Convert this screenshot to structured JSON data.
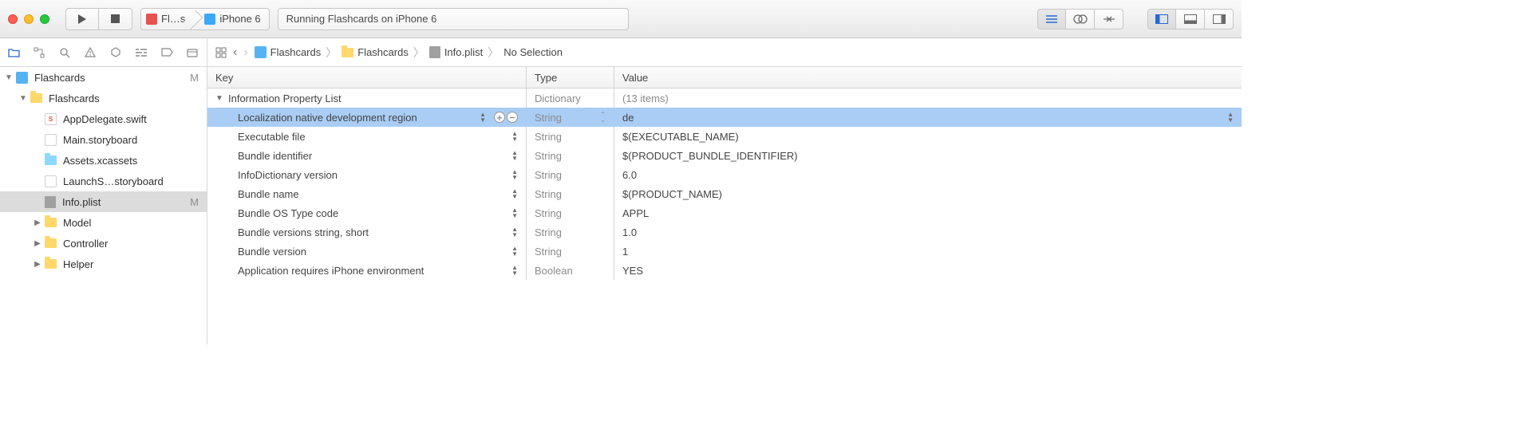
{
  "toolbar": {
    "scheme_target": "Fl…s",
    "scheme_device": "iPhone 6",
    "status": "Running Flashcards on iPhone 6"
  },
  "jump_bar": {
    "items": [
      {
        "icon": "project",
        "label": "Flashcards"
      },
      {
        "icon": "folder",
        "label": "Flashcards"
      },
      {
        "icon": "plist",
        "label": "Info.plist"
      },
      {
        "icon": "",
        "label": "No Selection"
      }
    ]
  },
  "sidebar": {
    "items": [
      {
        "depth": 0,
        "icon": "project",
        "label": "Flashcards",
        "badge": "M",
        "disclosure": "open"
      },
      {
        "depth": 1,
        "icon": "folder",
        "label": "Flashcards",
        "disclosure": "open"
      },
      {
        "depth": 2,
        "icon": "swift",
        "label": "AppDelegate.swift"
      },
      {
        "depth": 2,
        "icon": "storyboard",
        "label": "Main.storyboard"
      },
      {
        "depth": 2,
        "icon": "assets",
        "label": "Assets.xcassets"
      },
      {
        "depth": 2,
        "icon": "storyboard",
        "label": "LaunchS…storyboard"
      },
      {
        "depth": 2,
        "icon": "plist",
        "label": "Info.plist",
        "badge": "M",
        "selected": true
      },
      {
        "depth": 2,
        "icon": "folder",
        "label": "Model",
        "disclosure": "closed"
      },
      {
        "depth": 2,
        "icon": "folder",
        "label": "Controller",
        "disclosure": "closed"
      },
      {
        "depth": 2,
        "icon": "folder",
        "label": "Helper",
        "disclosure": "closed"
      }
    ]
  },
  "plist": {
    "columns": {
      "key": "Key",
      "type": "Type",
      "value": "Value"
    },
    "root": {
      "key": "Information Property List",
      "type": "Dictionary",
      "value": "(13 items)"
    },
    "rows": [
      {
        "key": "Localization native development region",
        "type": "String",
        "value": "de",
        "selected": true,
        "editable": true
      },
      {
        "key": "Executable file",
        "type": "String",
        "value": "$(EXECUTABLE_NAME)"
      },
      {
        "key": "Bundle identifier",
        "type": "String",
        "value": "$(PRODUCT_BUNDLE_IDENTIFIER)"
      },
      {
        "key": "InfoDictionary version",
        "type": "String",
        "value": "6.0"
      },
      {
        "key": "Bundle name",
        "type": "String",
        "value": "$(PRODUCT_NAME)"
      },
      {
        "key": "Bundle OS Type code",
        "type": "String",
        "value": "APPL"
      },
      {
        "key": "Bundle versions string, short",
        "type": "String",
        "value": "1.0"
      },
      {
        "key": "Bundle version",
        "type": "String",
        "value": "1"
      },
      {
        "key": "Application requires iPhone environment",
        "type": "Boolean",
        "value": "YES"
      }
    ]
  }
}
